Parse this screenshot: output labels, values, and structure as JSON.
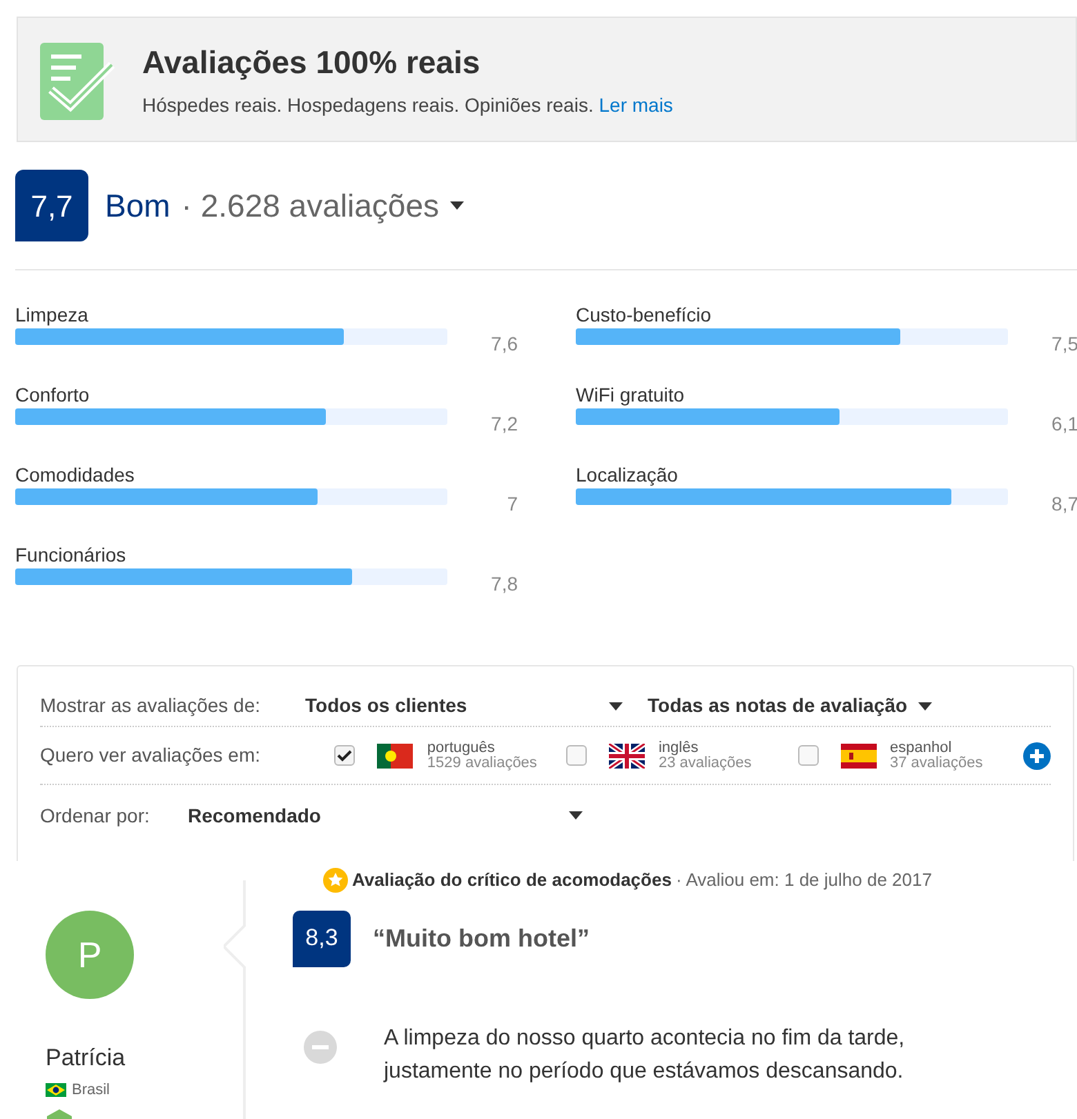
{
  "banner": {
    "title": "Avaliações 100% reais",
    "text": "Hóspedes reais. Hospedagens reais. Opiniões reais.",
    "link": "Ler mais"
  },
  "summary": {
    "score": "7,7",
    "label": "Bom",
    "separator": "·",
    "count": "2.628 avaliações"
  },
  "categories": [
    {
      "name": "Limpeza",
      "level": 0.76,
      "value": "7,6"
    },
    {
      "name": "Custo-benefício",
      "level": 0.75,
      "value": "7,5"
    },
    {
      "name": "Conforto",
      "level": 0.72,
      "value": "7,2"
    },
    {
      "name": "WiFi gratuito",
      "level": 0.61,
      "value": "6,1"
    },
    {
      "name": "Comodidades",
      "level": 0.7,
      "value": "7"
    },
    {
      "name": "Localização",
      "level": 0.87,
      "value": "8,7"
    },
    {
      "name": "Funcionários",
      "level": 0.78,
      "value": "7,8"
    }
  ],
  "filters": {
    "show_label": "Mostrar as avaliações de:",
    "audience": "Todos os clientes",
    "ratings": "Todas as notas de avaliação",
    "language_label": "Quero ver avaliações em:",
    "languages": [
      {
        "name": "português",
        "count": "1529 avaliações",
        "checked": true,
        "kind": "pt"
      },
      {
        "name": "inglês",
        "count": "23 avaliações",
        "checked": false,
        "kind": "gb"
      },
      {
        "name": "espanhol",
        "count": "37 avaliações",
        "checked": false,
        "kind": "es"
      }
    ],
    "sort_label": "Ordenar por:",
    "sort": "Recomendado"
  },
  "review": {
    "reviewer": {
      "initial": "P",
      "name": "Patrícia",
      "country": "Brasil"
    },
    "badge": "Avaliação do crítico de acomodações",
    "separator": "·",
    "date": "Avaliou em: 1 de julho de 2017",
    "score": "8,3",
    "title": "“Muito bom hotel”",
    "negative": "A limpeza do nosso quarto acontecia no fim da tarde, justamente no período que estávamos descansando."
  }
}
